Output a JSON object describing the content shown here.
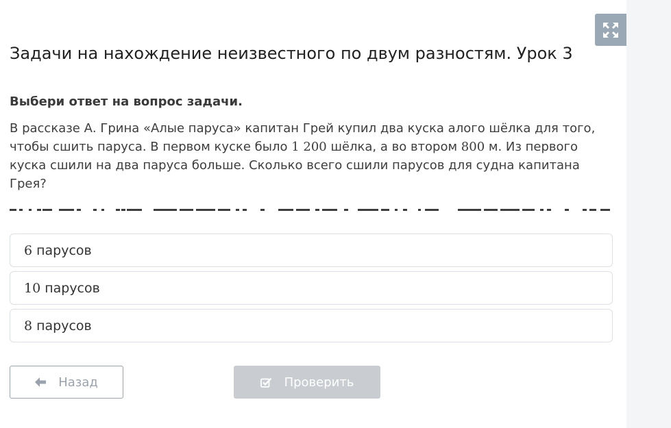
{
  "lesson": {
    "title": "Задачи на нахождение неизвестного по двум разностям. Урок 3"
  },
  "task": {
    "instruction": "Выбери ответ на вопрос задачи.",
    "text_1": "В рассказе А. Грина «Алые паруса» капитан Грей купил два куска алого шёлка для того, чтобы сшить паруса. В первом куске было ",
    "num_1": "1 200",
    "text_2": " шёлка, а во втором ",
    "num_2": "800",
    "text_3": " м. Из первого куска сшили на два паруса больше. Сколько всего сшили парусов для судна капитана Грея?"
  },
  "options": [
    {
      "num": "6",
      "label": "парусов"
    },
    {
      "num": "10",
      "label": "парусов"
    },
    {
      "num": "8",
      "label": "парусов"
    }
  ],
  "buttons": {
    "back_label": "Назад",
    "check_label": "Проверить"
  },
  "icons": {
    "expand": "expand-icon",
    "back": "arrow-left-icon",
    "check": "checkbox-icon"
  },
  "colors": {
    "expand_bg": "#9aa8b6",
    "check_disabled_bg": "#c9ccd0",
    "back_border": "#9aa3ad",
    "gutter_bg": "#f4f5f7"
  }
}
